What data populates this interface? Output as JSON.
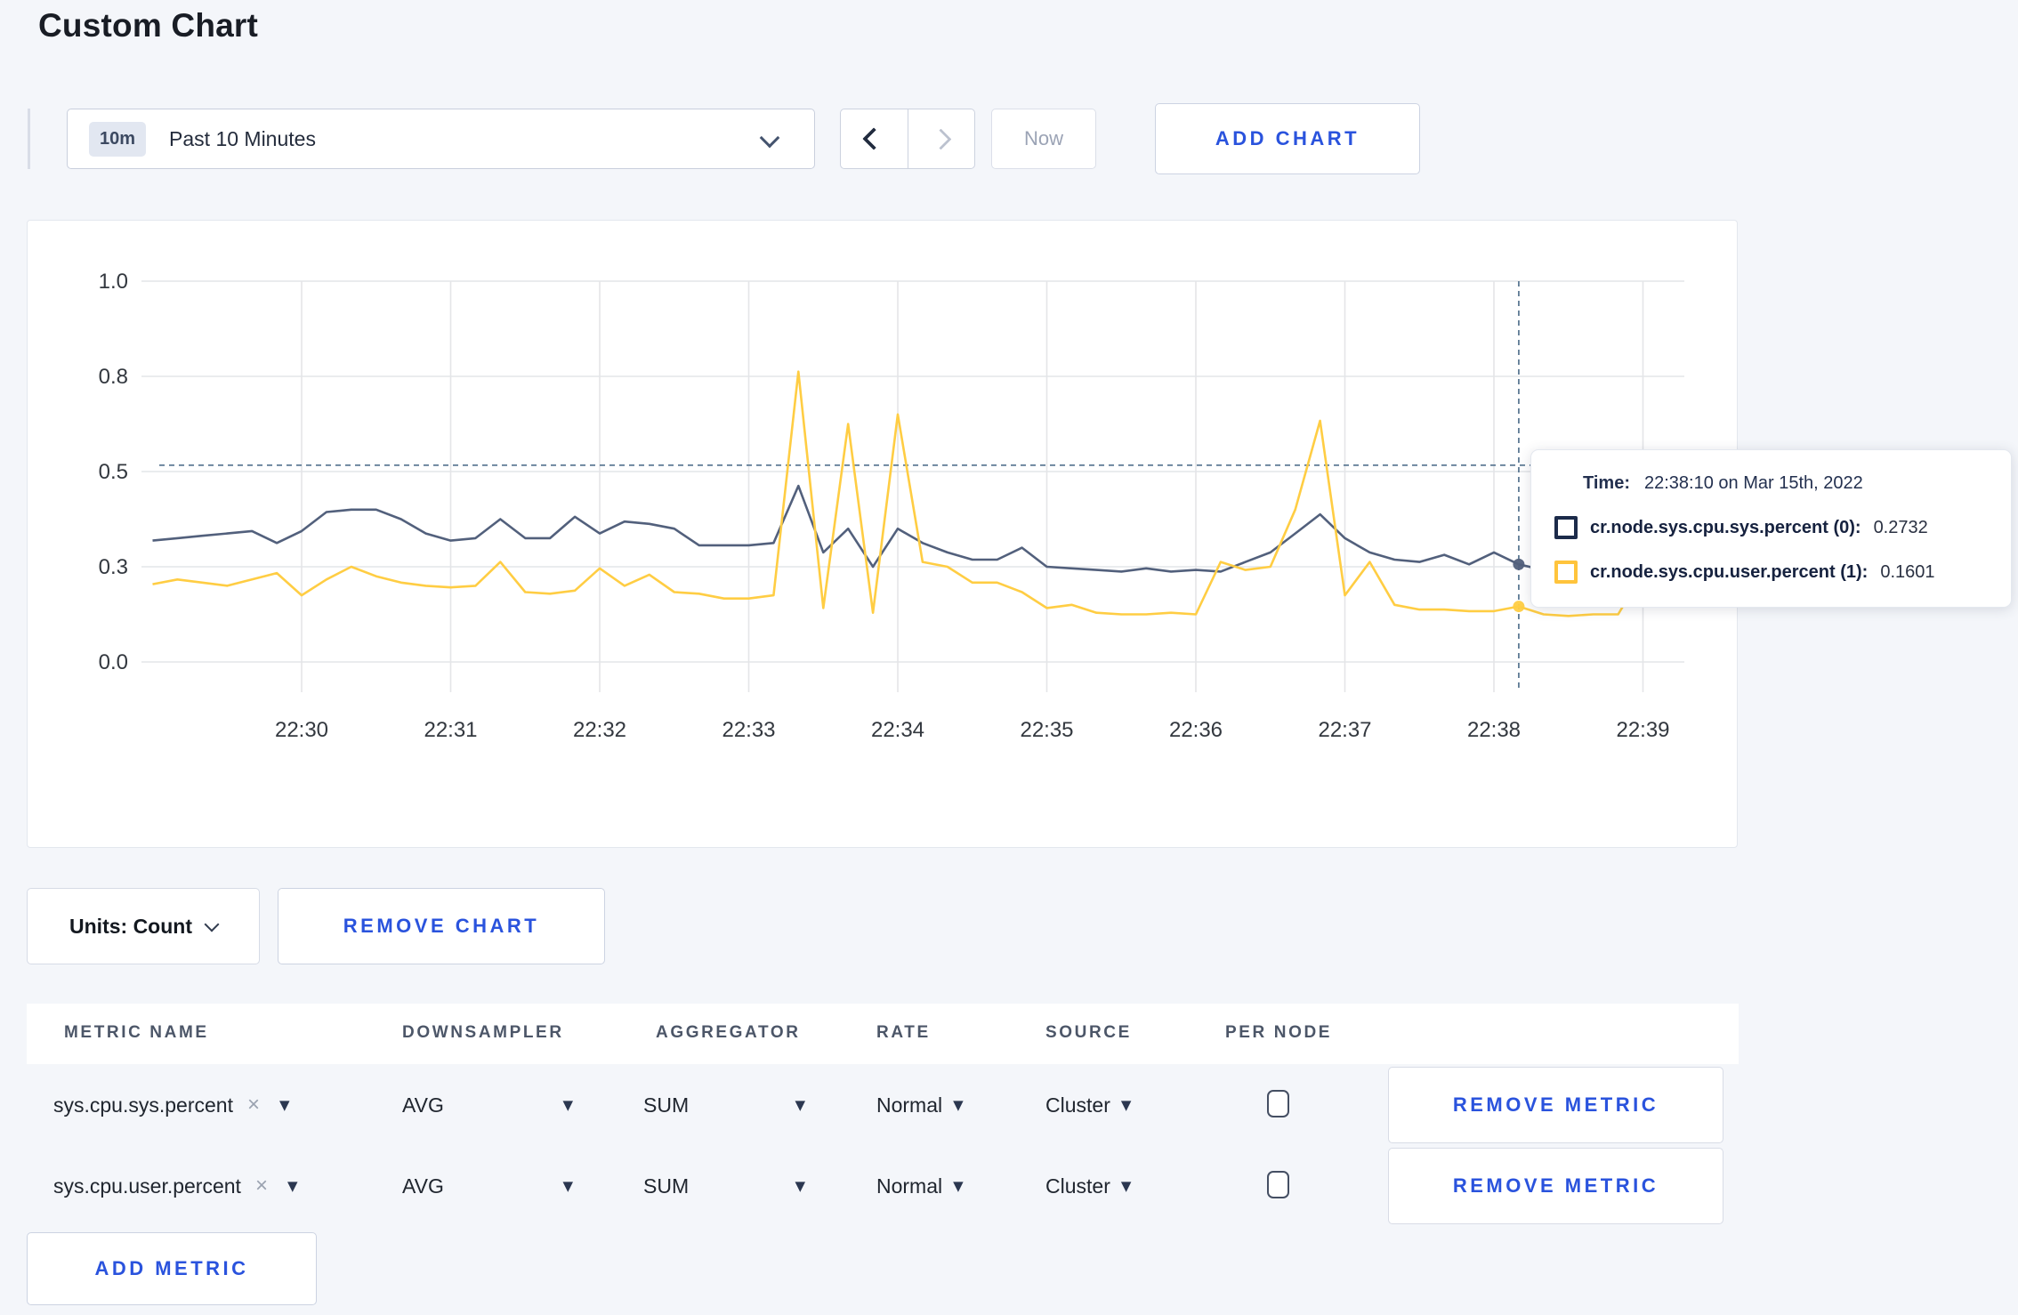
{
  "page": {
    "title": "Custom Chart",
    "background": "#f4f6fa",
    "accent_blue": "#2a53dd"
  },
  "icons": {
    "dropdown_arrow": "▼",
    "clear": "×"
  },
  "controls": {
    "time_window": {
      "badge": "10m",
      "label": "Past 10 Minutes"
    },
    "now_label": "Now",
    "add_chart_label": "ADD CHART"
  },
  "chart_data": {
    "type": "line",
    "title": "",
    "x_start": "22:29:00",
    "x_interval_seconds": 10,
    "x_ticks": [
      "22:30",
      "22:31",
      "22:32",
      "22:33",
      "22:34",
      "22:35",
      "22:36",
      "22:37",
      "22:38",
      "22:39"
    ],
    "y_ticks": [
      "1.0",
      "0.8",
      "0.5",
      "0.3",
      "0.0"
    ],
    "y_tick_values": [
      1.0,
      0.8,
      0.5,
      0.3,
      0.0
    ],
    "ylim": [
      0,
      1.0
    ],
    "grid": true,
    "legend_position": "tooltip",
    "colors": {
      "grid": "#e4e5e8",
      "axis_text": "#33383f",
      "crosshair": "#5e7b95"
    },
    "series": [
      {
        "name": "cr.node.sys.cpu.sys.percent (0)",
        "color": "#52607c",
        "values": [
          0.355,
          0.36,
          0.365,
          0.37,
          0.375,
          0.35,
          0.375,
          0.415,
          0.42,
          0.42,
          0.4,
          0.37,
          0.355,
          0.36,
          0.4,
          0.36,
          0.36,
          0.405,
          0.37,
          0.395,
          0.39,
          0.38,
          0.345,
          0.345,
          0.345,
          0.35,
          0.47,
          0.33,
          0.38,
          0.3,
          0.38,
          0.35,
          0.33,
          0.315,
          0.315,
          0.34,
          0.3,
          0.295,
          0.29,
          0.285,
          0.295,
          0.285,
          0.29,
          0.285,
          0.31,
          0.33,
          0.37,
          0.41,
          0.36,
          0.33,
          0.315,
          0.31,
          0.325,
          0.305,
          0.33,
          0.305,
          0.29,
          0.29,
          0.3,
          0.29,
          0.3,
          0.31,
          0.3
        ]
      },
      {
        "name": "cr.node.sys.cpu.user.percent (1)",
        "color": "#ffcd43",
        "values": [
          0.245,
          0.26,
          0.25,
          0.24,
          0.26,
          0.28,
          0.21,
          0.26,
          0.3,
          0.27,
          0.25,
          0.24,
          0.235,
          0.24,
          0.31,
          0.22,
          0.215,
          0.225,
          0.295,
          0.24,
          0.275,
          0.22,
          0.215,
          0.2,
          0.2,
          0.21,
          0.81,
          0.17,
          0.65,
          0.155,
          0.68,
          0.31,
          0.3,
          0.25,
          0.25,
          0.22,
          0.17,
          0.18,
          0.155,
          0.15,
          0.15,
          0.155,
          0.15,
          0.31,
          0.29,
          0.3,
          0.42,
          0.66,
          0.21,
          0.31,
          0.18,
          0.165,
          0.165,
          0.16,
          0.16,
          0.175,
          0.15,
          0.145,
          0.15,
          0.15,
          0.28,
          0.33,
          0.25
        ]
      }
    ],
    "crosshair": {
      "time": "22:38:10",
      "point_index": 55,
      "hline_value": 0.52
    }
  },
  "tooltip": {
    "time_label": "Time:",
    "time_value": "22:38:10 on Mar 15th, 2022",
    "rows": [
      {
        "swatch_color": "#1c2b4a",
        "label": "cr.node.sys.cpu.sys.percent (0):",
        "value": "0.2732"
      },
      {
        "swatch_color": "#ffc43c",
        "label": "cr.node.sys.cpu.user.percent (1):",
        "value": "0.1601"
      }
    ]
  },
  "units_row": {
    "units_label": "Units: Count",
    "remove_chart_label": "REMOVE CHART"
  },
  "metrics": {
    "headers": [
      "METRIC NAME",
      "DOWNSAMPLER",
      "AGGREGATOR",
      "RATE",
      "SOURCE",
      "PER NODE"
    ],
    "rows": [
      {
        "metric": "sys.cpu.sys.percent",
        "downsampler": "AVG",
        "aggregator": "SUM",
        "rate": "Normal",
        "source": "Cluster",
        "per_node_checked": false,
        "remove_label": "REMOVE METRIC"
      },
      {
        "metric": "sys.cpu.user.percent",
        "downsampler": "AVG",
        "aggregator": "SUM",
        "rate": "Normal",
        "source": "Cluster",
        "per_node_checked": false,
        "remove_label": "REMOVE METRIC"
      }
    ],
    "add_metric_label": "ADD METRIC"
  }
}
